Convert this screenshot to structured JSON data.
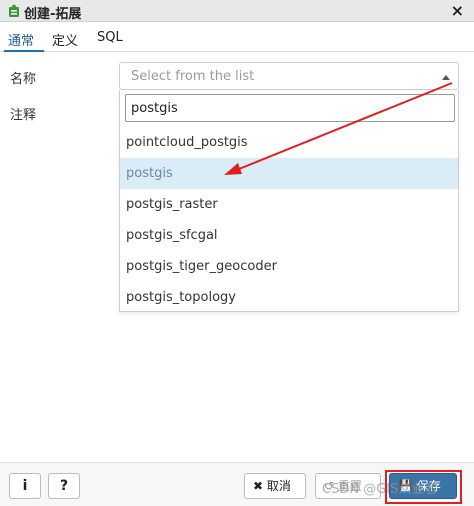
{
  "window": {
    "title": "创建-拓展",
    "icon": "puzzle-piece-icon",
    "close_glyph": "×"
  },
  "tabs": [
    {
      "label": "通常",
      "active": true
    },
    {
      "label": "定义",
      "active": false
    },
    {
      "label": "SQL",
      "active": false
    }
  ],
  "form": {
    "name_label": "名称",
    "comment_label": "注释",
    "select_placeholder": "Select from the list",
    "search_value": "postgis"
  },
  "options": [
    {
      "label": "pointcloud_postgis",
      "highlighted": false
    },
    {
      "label": "postgis",
      "highlighted": true
    },
    {
      "label": "postgis_raster",
      "highlighted": false
    },
    {
      "label": "postgis_sfcgal",
      "highlighted": false
    },
    {
      "label": "postgis_tiger_geocoder",
      "highlighted": false
    },
    {
      "label": "postgis_topology",
      "highlighted": false
    }
  ],
  "footer": {
    "info_glyph": "i",
    "help_glyph": "?",
    "cancel_label": "✖ 取消",
    "reset_label": "↺ 重置",
    "save_label": "💾 保存"
  },
  "watermark": "CSDN @GIS从业者",
  "colors": {
    "accent": "#1f6fb0",
    "highlight": "#d9ecf7",
    "annotation": "#e02020",
    "primary": "#3b74a6"
  }
}
